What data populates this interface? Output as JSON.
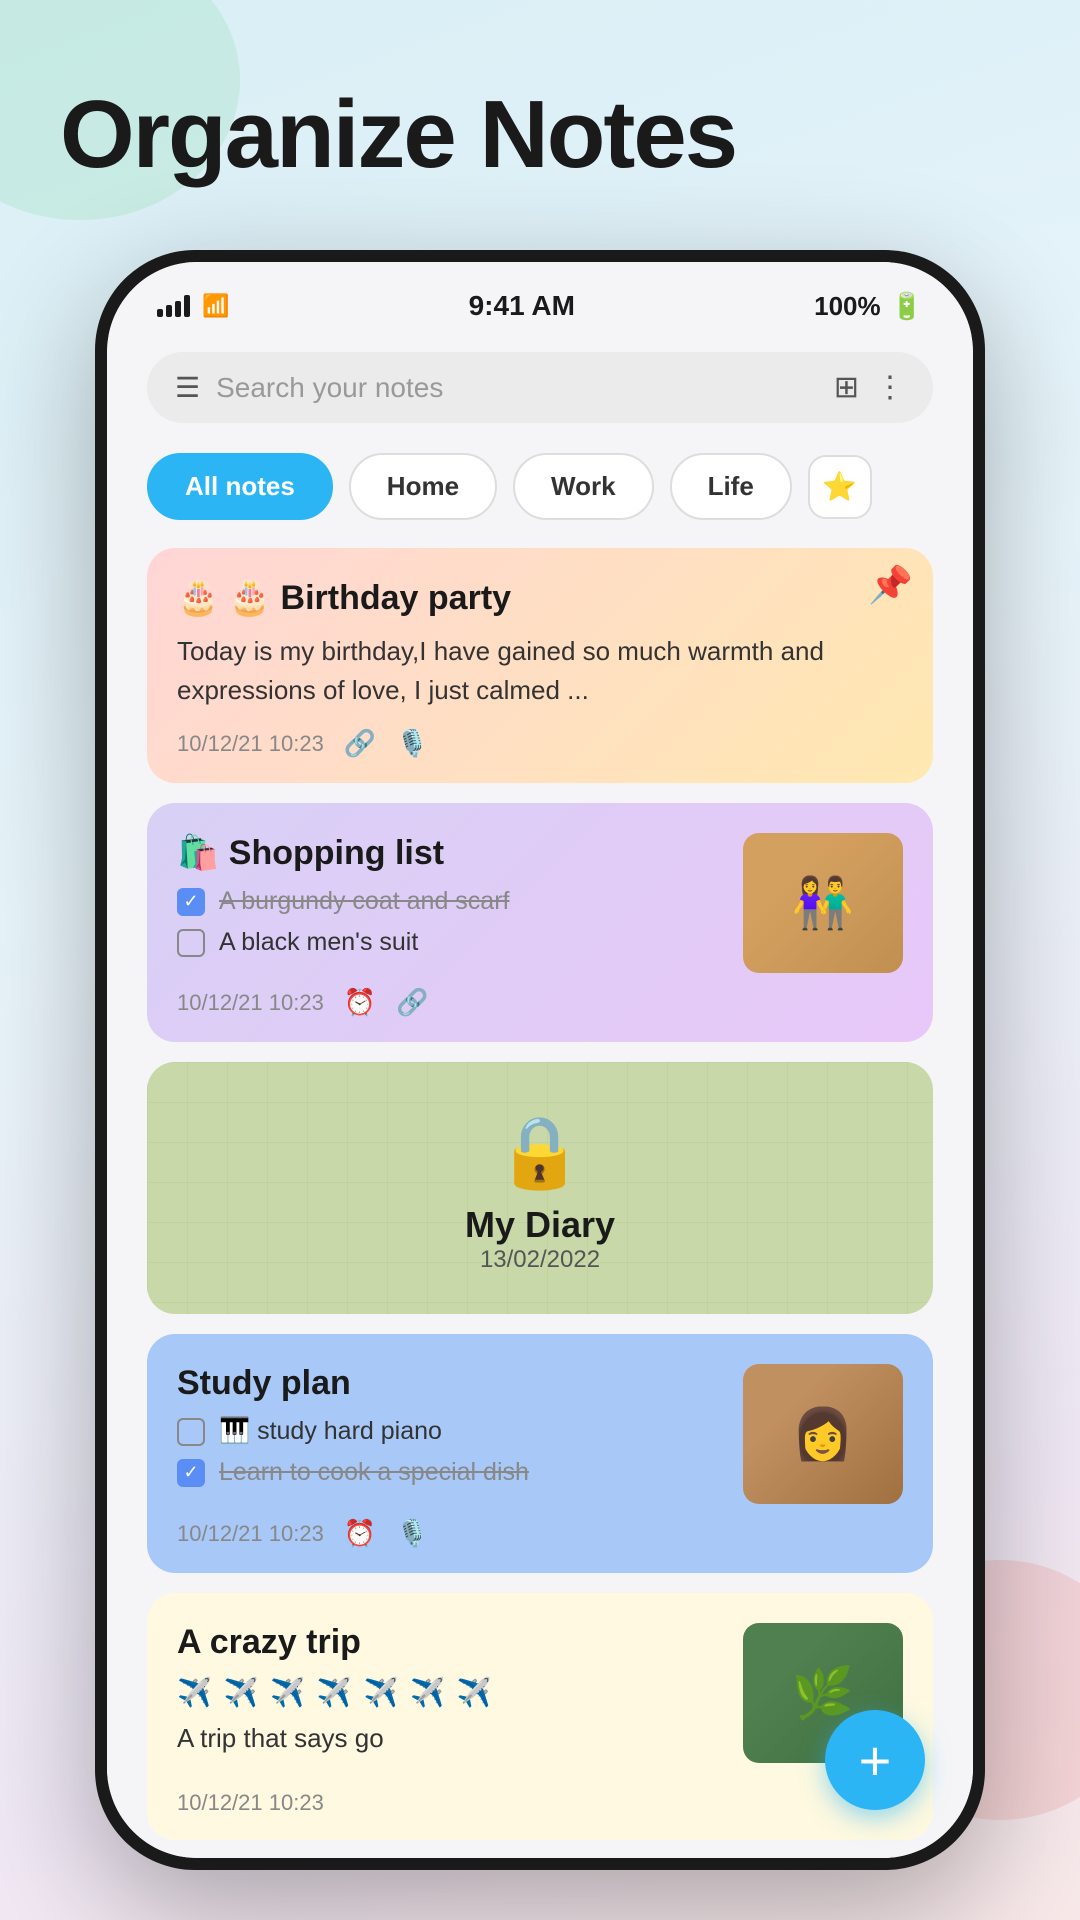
{
  "page": {
    "title": "Organize Notes",
    "background": "#d8eef5"
  },
  "status_bar": {
    "time": "9:41 AM",
    "battery": "100%",
    "signal": "full",
    "wifi": true
  },
  "search": {
    "placeholder": "Search your notes"
  },
  "filter_tabs": [
    {
      "label": "All notes",
      "active": true
    },
    {
      "label": "Home",
      "active": false
    },
    {
      "label": "Work",
      "active": false
    },
    {
      "label": "Life",
      "active": false
    }
  ],
  "notes": [
    {
      "id": "birthday",
      "title": "🎂 🎂 Birthday party",
      "body": "Today is my birthday,I have gained so much warmth and expressions of love, I just calmed ...",
      "date": "10/12/21 10:23",
      "icons": [
        "link",
        "microphone"
      ],
      "pinned": true,
      "color": "gradient-orange-yellow"
    },
    {
      "id": "shopping",
      "title": "🛍️ Shopping list",
      "items": [
        {
          "text": "A burgundy coat and scarf",
          "checked": true
        },
        {
          "text": "A black men's suit",
          "checked": false
        }
      ],
      "date": "10/12/21 10:23",
      "icons": [
        "alarm",
        "link"
      ],
      "has_image": true,
      "color": "gradient-purple"
    },
    {
      "id": "diary",
      "title": "My Diary",
      "date": "13/02/2022",
      "locked": true,
      "color": "green-grid"
    },
    {
      "id": "study",
      "title": "Study plan",
      "items": [
        {
          "text": "🎹 study hard piano",
          "checked": false
        },
        {
          "text": "Learn to cook a special dish",
          "checked": true
        }
      ],
      "date": "10/12/21 10:23",
      "icons": [
        "alarm",
        "microphone"
      ],
      "has_image": true,
      "color": "blue"
    },
    {
      "id": "trip",
      "title": "A crazy trip",
      "emoji_row": "✈️ ✈️ ✈️ ✈️ ✈️ ✈️ ✈️",
      "body": "A trip that says go",
      "date": "10/12/21 10:23",
      "has_image": true,
      "color": "yellow"
    }
  ],
  "fab": {
    "label": "+"
  }
}
